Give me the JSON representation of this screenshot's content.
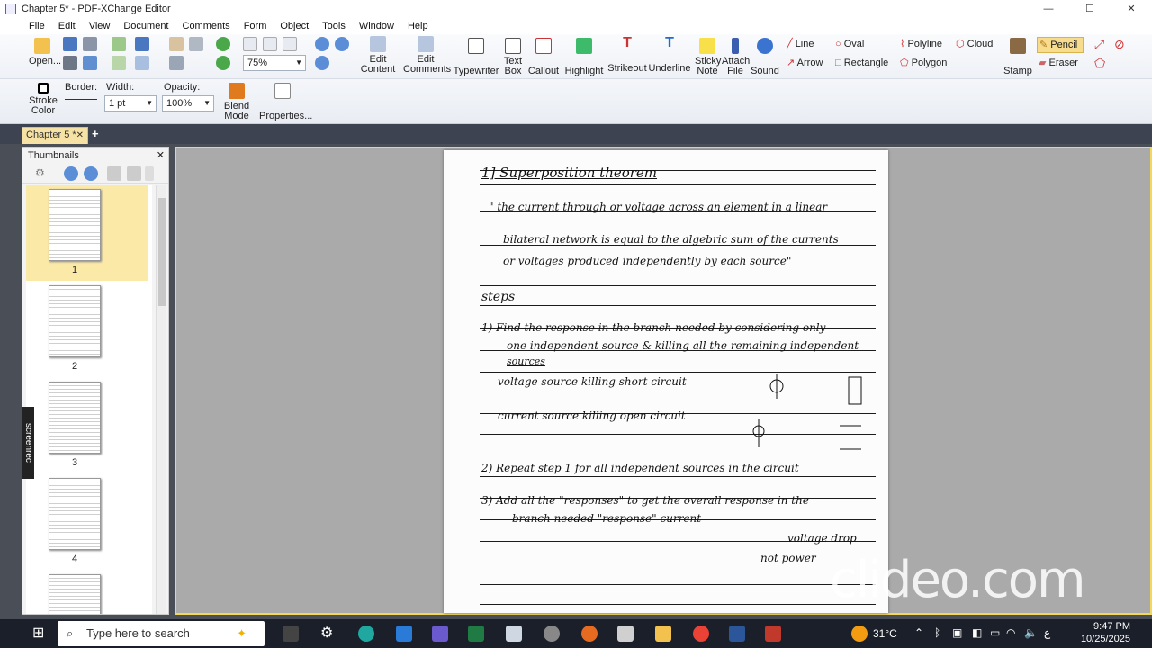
{
  "window": {
    "title": "Chapter 5* - PDF-XChange Editor"
  },
  "menu": [
    "File",
    "Edit",
    "View",
    "Document",
    "Comments",
    "Form",
    "Object",
    "Tools",
    "Window",
    "Help"
  ],
  "toolbar": {
    "open": "Open...",
    "zoom": "75%",
    "edit_content": [
      "Edit",
      "Content"
    ],
    "edit_comments": [
      "Edit",
      "Comments"
    ],
    "typewriter": "Typewriter",
    "text_box": [
      "Text",
      "Box"
    ],
    "callout": "Callout",
    "highlight": "Highlight",
    "strikeout": "Strikeout",
    "underline": "Underline",
    "sticky_note": [
      "Sticky",
      "Note"
    ],
    "attach_file": [
      "Attach",
      "File"
    ],
    "sound": "Sound",
    "line": "Line",
    "oval": "Oval",
    "polyline": "Polyline",
    "cloud": "Cloud",
    "arrow": "Arrow",
    "rectangle": "Rectangle",
    "polygon": "Polygon",
    "stamp": "Stamp",
    "pencil": "Pencil",
    "eraser": "Eraser"
  },
  "props": {
    "stroke_color": [
      "Stroke",
      "Color"
    ],
    "border_label": "Border:",
    "width_label": "Width:",
    "width_value": "1 pt",
    "opacity_label": "Opacity:",
    "opacity_value": "100%",
    "blend_mode": [
      "Blend",
      "Mode"
    ],
    "properties": "Properties..."
  },
  "tab": {
    "label": "Chapter 5 *"
  },
  "thumbnails": {
    "title": "Thumbnails",
    "pages": [
      "1",
      "2",
      "3",
      "4"
    ]
  },
  "document_lines": [
    "1] Superposition theorem",
    "\" the current through or voltage across an element in a linear",
    "bilateral network is equal to the algebric sum of the currents",
    "or voltages produced independently by each source\"",
    "steps",
    "1) Find the response in the branch needed by considering only",
    "one independent source & killing all the remaining independent",
    "sources",
    "voltage source  killing  short circuit",
    "current source  killing  open circuit",
    "2) Repeat step 1 for all independent sources in the circuit",
    "3) Add all the \"responses\" to get the overall response in the",
    "branch needed  \"response\"  current",
    "voltage drop",
    "not power"
  ],
  "watermark": "clideo.com",
  "screenrec": "screenrec",
  "taskbar": {
    "search_placeholder": "Type here to search",
    "temperature": "31°C",
    "time": "9:47 PM",
    "date": "10/25/2025",
    "lang": "ع"
  }
}
